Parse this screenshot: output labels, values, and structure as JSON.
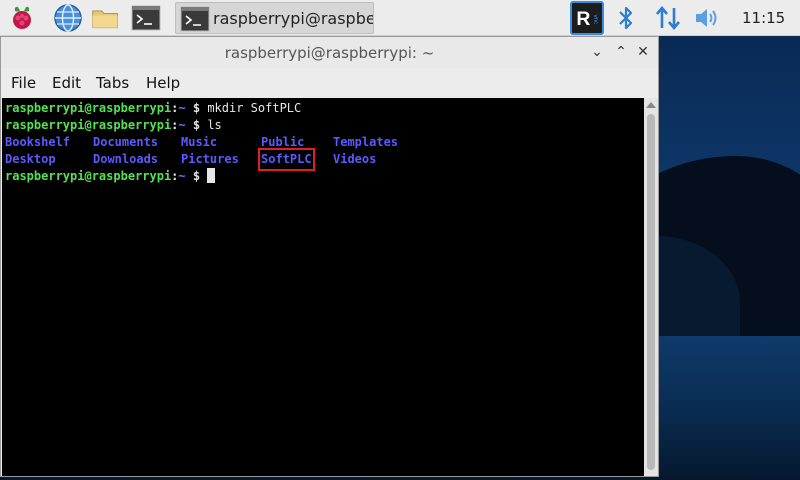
{
  "taskbar": {
    "task_button_label": "raspberrypi@raspberr",
    "clock": "11:15",
    "icons": [
      "raspberry-pi-menu-icon",
      "web-browser-icon",
      "file-manager-icon",
      "terminal-icon",
      "vnc-icon",
      "bluetooth-icon",
      "network-icon",
      "volume-icon"
    ]
  },
  "window": {
    "title": "raspberrypi@raspberrypi: ~",
    "menu": [
      "File",
      "Edit",
      "Tabs",
      "Help"
    ]
  },
  "terminal": {
    "prompt_user": "raspberrypi@raspberrypi",
    "prompt_sep": ":",
    "prompt_path": "~",
    "prompt_symbol": " $ ",
    "commands": [
      "mkdir SoftPLC",
      "ls"
    ],
    "ls_output": [
      [
        "Bookshelf",
        "Documents",
        "Music",
        "Public",
        "Templates"
      ],
      [
        "Desktop",
        "Downloads",
        "Pictures",
        "SoftPLC",
        "Videos"
      ]
    ],
    "highlighted_entry": "SoftPLC"
  },
  "colors": {
    "prompt_user": "#55e155",
    "prompt_path": "#6f6fff",
    "directory": "#5a5aff",
    "highlight_box": "#e02020"
  }
}
